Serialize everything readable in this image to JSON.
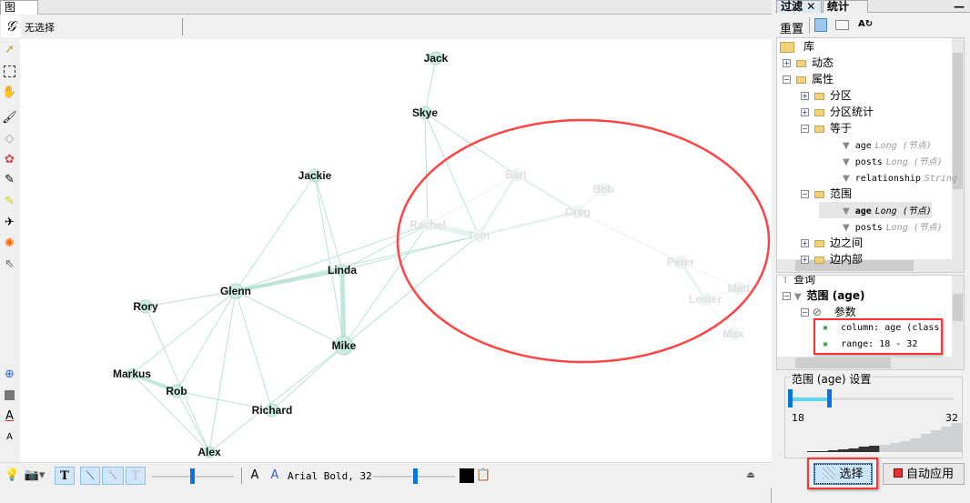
{
  "graph_tab": {
    "label": "图",
    "close": "✕"
  },
  "selection_status": "无选择",
  "graph": {
    "nodes": [
      {
        "id": "Jack",
        "faded": false
      },
      {
        "id": "Skye",
        "faded": false
      },
      {
        "id": "Jackie",
        "faded": false
      },
      {
        "id": "Linda",
        "faded": false
      },
      {
        "id": "Glenn",
        "faded": false
      },
      {
        "id": "Rory",
        "faded": false
      },
      {
        "id": "Mike",
        "faded": false
      },
      {
        "id": "Markus",
        "faded": false
      },
      {
        "id": "Rob",
        "faded": false
      },
      {
        "id": "Richard",
        "faded": false
      },
      {
        "id": "Alex",
        "faded": false
      },
      {
        "id": "Bart",
        "faded": true
      },
      {
        "id": "Bob",
        "faded": true
      },
      {
        "id": "Greg",
        "faded": true
      },
      {
        "id": "Rachel",
        "faded": true
      },
      {
        "id": "Tom",
        "faded": true
      },
      {
        "id": "Peter",
        "faded": true
      },
      {
        "id": "Lester",
        "faded": true
      },
      {
        "id": "Matt",
        "faded": true
      },
      {
        "id": "Max",
        "faded": true
      }
    ],
    "edges": [
      [
        "Jack",
        "Skye",
        1
      ],
      [
        "Skye",
        "Tom",
        1
      ],
      [
        "Skye",
        "Rachel",
        1
      ],
      [
        "Skye",
        "Bart",
        1
      ],
      [
        "Jackie",
        "Linda",
        1
      ],
      [
        "Jackie",
        "Glenn",
        1
      ],
      [
        "Jackie",
        "Mike",
        1
      ],
      [
        "Glenn",
        "Linda",
        4
      ],
      [
        "Linda",
        "Mike",
        5
      ],
      [
        "Glenn",
        "Rory",
        1
      ],
      [
        "Glenn",
        "Markus",
        1
      ],
      [
        "Glenn",
        "Rob",
        1
      ],
      [
        "Glenn",
        "Richard",
        1
      ],
      [
        "Glenn",
        "Alex",
        1
      ],
      [
        "Glenn",
        "Mike",
        1
      ],
      [
        "Markus",
        "Rob",
        4
      ],
      [
        "Markus",
        "Alex",
        1
      ],
      [
        "Rob",
        "Richard",
        1
      ],
      [
        "Rob",
        "Alex",
        1
      ],
      [
        "Richard",
        "Mike",
        1
      ],
      [
        "Alex",
        "Mike",
        1
      ],
      [
        "Rory",
        "Alex",
        1
      ],
      [
        "Linda",
        "Rachel",
        1
      ],
      [
        "Linda",
        "Tom",
        1
      ],
      [
        "Glenn",
        "Rachel",
        1
      ],
      [
        "Glenn",
        "Tom",
        1
      ],
      [
        "Mike",
        "Rachel",
        1
      ],
      [
        "Mike",
        "Tom",
        1
      ],
      [
        "Rachel",
        "Tom",
        6
      ],
      [
        "Tom",
        "Bart",
        3
      ],
      [
        "Tom",
        "Greg",
        3
      ],
      [
        "Bart",
        "Greg",
        3
      ],
      [
        "Greg",
        "Bob",
        1
      ],
      [
        "Greg",
        "Peter",
        1
      ],
      [
        "Rachel",
        "Bart",
        1
      ],
      [
        "Peter",
        "Lester",
        3
      ],
      [
        "Peter",
        "Matt",
        1
      ],
      [
        "Lester",
        "Matt",
        1
      ],
      [
        "Lester",
        "Max",
        1
      ],
      [
        "Matt",
        "Max",
        1
      ]
    ]
  },
  "bottom_toolbar": {
    "font_label": "Arial Bold, 32",
    "text_icon": "T",
    "outline_text_icon": "T",
    "font_size_icon": "A",
    "font_color_icon": "A"
  },
  "right": {
    "tabs": [
      {
        "label": "过滤",
        "close": "✕"
      },
      {
        "label": "统计"
      }
    ],
    "minimize": "—",
    "reset": "重置",
    "library_tree": [
      {
        "label": "库",
        "level": 0,
        "kind": "folder"
      },
      {
        "label": "动态",
        "level": 1,
        "kind": "folder",
        "toggle": "+"
      },
      {
        "label": "属性",
        "level": 1,
        "kind": "folder",
        "toggle": "−"
      },
      {
        "label": "分区",
        "level": 2,
        "kind": "folder",
        "toggle": "+"
      },
      {
        "label": "分区统计",
        "level": 2,
        "kind": "folder",
        "toggle": "+"
      },
      {
        "label": "等于",
        "level": 2,
        "kind": "folder",
        "toggle": "−"
      },
      {
        "label": "age",
        "type": "Long (节点)",
        "level": 3,
        "kind": "filter"
      },
      {
        "label": "posts",
        "type": "Long (节点)",
        "level": 3,
        "kind": "filter"
      },
      {
        "label": "relationship",
        "type": "String",
        "level": 3,
        "kind": "filter"
      },
      {
        "label": "范围",
        "level": 2,
        "kind": "folder",
        "toggle": "−"
      },
      {
        "label": "age",
        "type": "Long (节点)",
        "level": 3,
        "kind": "filter",
        "selected": true
      },
      {
        "label": "posts",
        "type": "Long (节点)",
        "level": 3,
        "kind": "filter"
      },
      {
        "label": "边之间",
        "level": 2,
        "kind": "folder",
        "toggle": "+"
      },
      {
        "label": "边内部",
        "level": 2,
        "kind": "folder",
        "toggle": "+"
      }
    ],
    "query_tree": {
      "root": "查询",
      "filter": "范围 (age)",
      "params": "参数",
      "column": "column: age (class",
      "range": "range: 18 - 32"
    },
    "settings": {
      "title": "范围 (age) 设置",
      "min": "18",
      "max": "32",
      "low_fraction": 0.0,
      "high_fraction": 0.24
    },
    "select_button": "选择",
    "auto_apply_button": "自动应用"
  }
}
